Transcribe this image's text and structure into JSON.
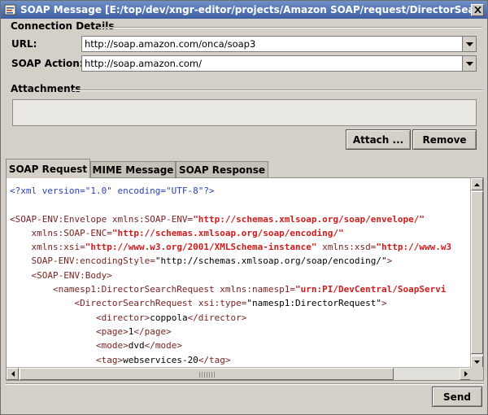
{
  "window": {
    "title": "SOAP Message [E:/top/dev/xngr-editor/projects/Amazon SOAP/request/DirectorSearch.xml]",
    "icons": {
      "app": "xml-app-icon",
      "close": "close-icon"
    }
  },
  "connection": {
    "heading": "Connection Details",
    "url_label": "URL:",
    "url_value": "http://soap.amazon.com/onca/soap3",
    "action_label": "SOAP Action:",
    "action_value": "http://soap.amazon.com/"
  },
  "attachments": {
    "heading": "Attachments",
    "attach_button": "Attach ...",
    "remove_button": "Remove"
  },
  "tabs": [
    {
      "label": "SOAP Request",
      "active": true
    },
    {
      "label": "MIME Message",
      "active": false
    },
    {
      "label": "SOAP Response",
      "active": false
    }
  ],
  "editor": {
    "lines": [
      [
        {
          "c": "pi",
          "t": "<?xml version=\"1.0\" encoding=\"UTF-8\"?>"
        }
      ],
      [],
      [
        {
          "c": "tag",
          "t": "<SOAP-ENV:Envelope "
        },
        {
          "c": "attr",
          "t": "xmlns:SOAP-ENV="
        },
        {
          "c": "val",
          "t": "\"http://schemas.xmlsoap.org/soap/envelope/\""
        }
      ],
      [
        {
          "c": "pl",
          "t": "    "
        },
        {
          "c": "attr",
          "t": "xmlns:SOAP-ENC="
        },
        {
          "c": "val",
          "t": "\"http://schemas.xmlsoap.org/soap/encoding/\""
        }
      ],
      [
        {
          "c": "pl",
          "t": "    "
        },
        {
          "c": "attr",
          "t": "xmlns:xsi="
        },
        {
          "c": "val",
          "t": "\"http://www.w3.org/2001/XMLSchema-instance\""
        },
        {
          "c": "pl",
          "t": " "
        },
        {
          "c": "attr",
          "t": "xmlns:xsd="
        },
        {
          "c": "val",
          "t": "\"http://www.w3"
        }
      ],
      [
        {
          "c": "pl",
          "t": "    "
        },
        {
          "c": "attr",
          "t": "SOAP-ENV:encodingStyle="
        },
        {
          "c": "pl",
          "t": "\"http://schemas.xmlsoap.org/soap/encoding/\""
        },
        {
          "c": "tag",
          "t": ">"
        }
      ],
      [
        {
          "c": "pl",
          "t": "    "
        },
        {
          "c": "tag",
          "t": "<SOAP-ENV:Body>"
        }
      ],
      [
        {
          "c": "pl",
          "t": "        "
        },
        {
          "c": "tag",
          "t": "<namesp1:DirectorSearchRequest "
        },
        {
          "c": "attr",
          "t": "xmlns:namesp1="
        },
        {
          "c": "val",
          "t": "\"urn:PI/DevCentral/SoapServi"
        }
      ],
      [
        {
          "c": "pl",
          "t": "            "
        },
        {
          "c": "tag",
          "t": "<DirectorSearchRequest "
        },
        {
          "c": "attr",
          "t": "xsi:type="
        },
        {
          "c": "pl",
          "t": "\"namesp1:DirectorRequest\""
        },
        {
          "c": "tag",
          "t": ">"
        }
      ],
      [
        {
          "c": "pl",
          "t": "                "
        },
        {
          "c": "tag",
          "t": "<director>"
        },
        {
          "c": "pl",
          "t": "coppola"
        },
        {
          "c": "tag",
          "t": "</director>"
        }
      ],
      [
        {
          "c": "pl",
          "t": "                "
        },
        {
          "c": "tag",
          "t": "<page>"
        },
        {
          "c": "pl",
          "t": "1"
        },
        {
          "c": "tag",
          "t": "</page>"
        }
      ],
      [
        {
          "c": "pl",
          "t": "                "
        },
        {
          "c": "tag",
          "t": "<mode>"
        },
        {
          "c": "pl",
          "t": "dvd"
        },
        {
          "c": "tag",
          "t": "</mode>"
        }
      ],
      [
        {
          "c": "pl",
          "t": "                "
        },
        {
          "c": "tag",
          "t": "<tag>"
        },
        {
          "c": "pl",
          "t": "webservices-20"
        },
        {
          "c": "tag",
          "t": "</tag>"
        }
      ]
    ]
  },
  "footer": {
    "send_button": "Send"
  },
  "colors": {
    "window": "#d4d0c8",
    "titlebar": "#3d5fa3",
    "tag": "#7a1e1e",
    "value": "#d11a1a",
    "pi": "#2a3fc0"
  }
}
